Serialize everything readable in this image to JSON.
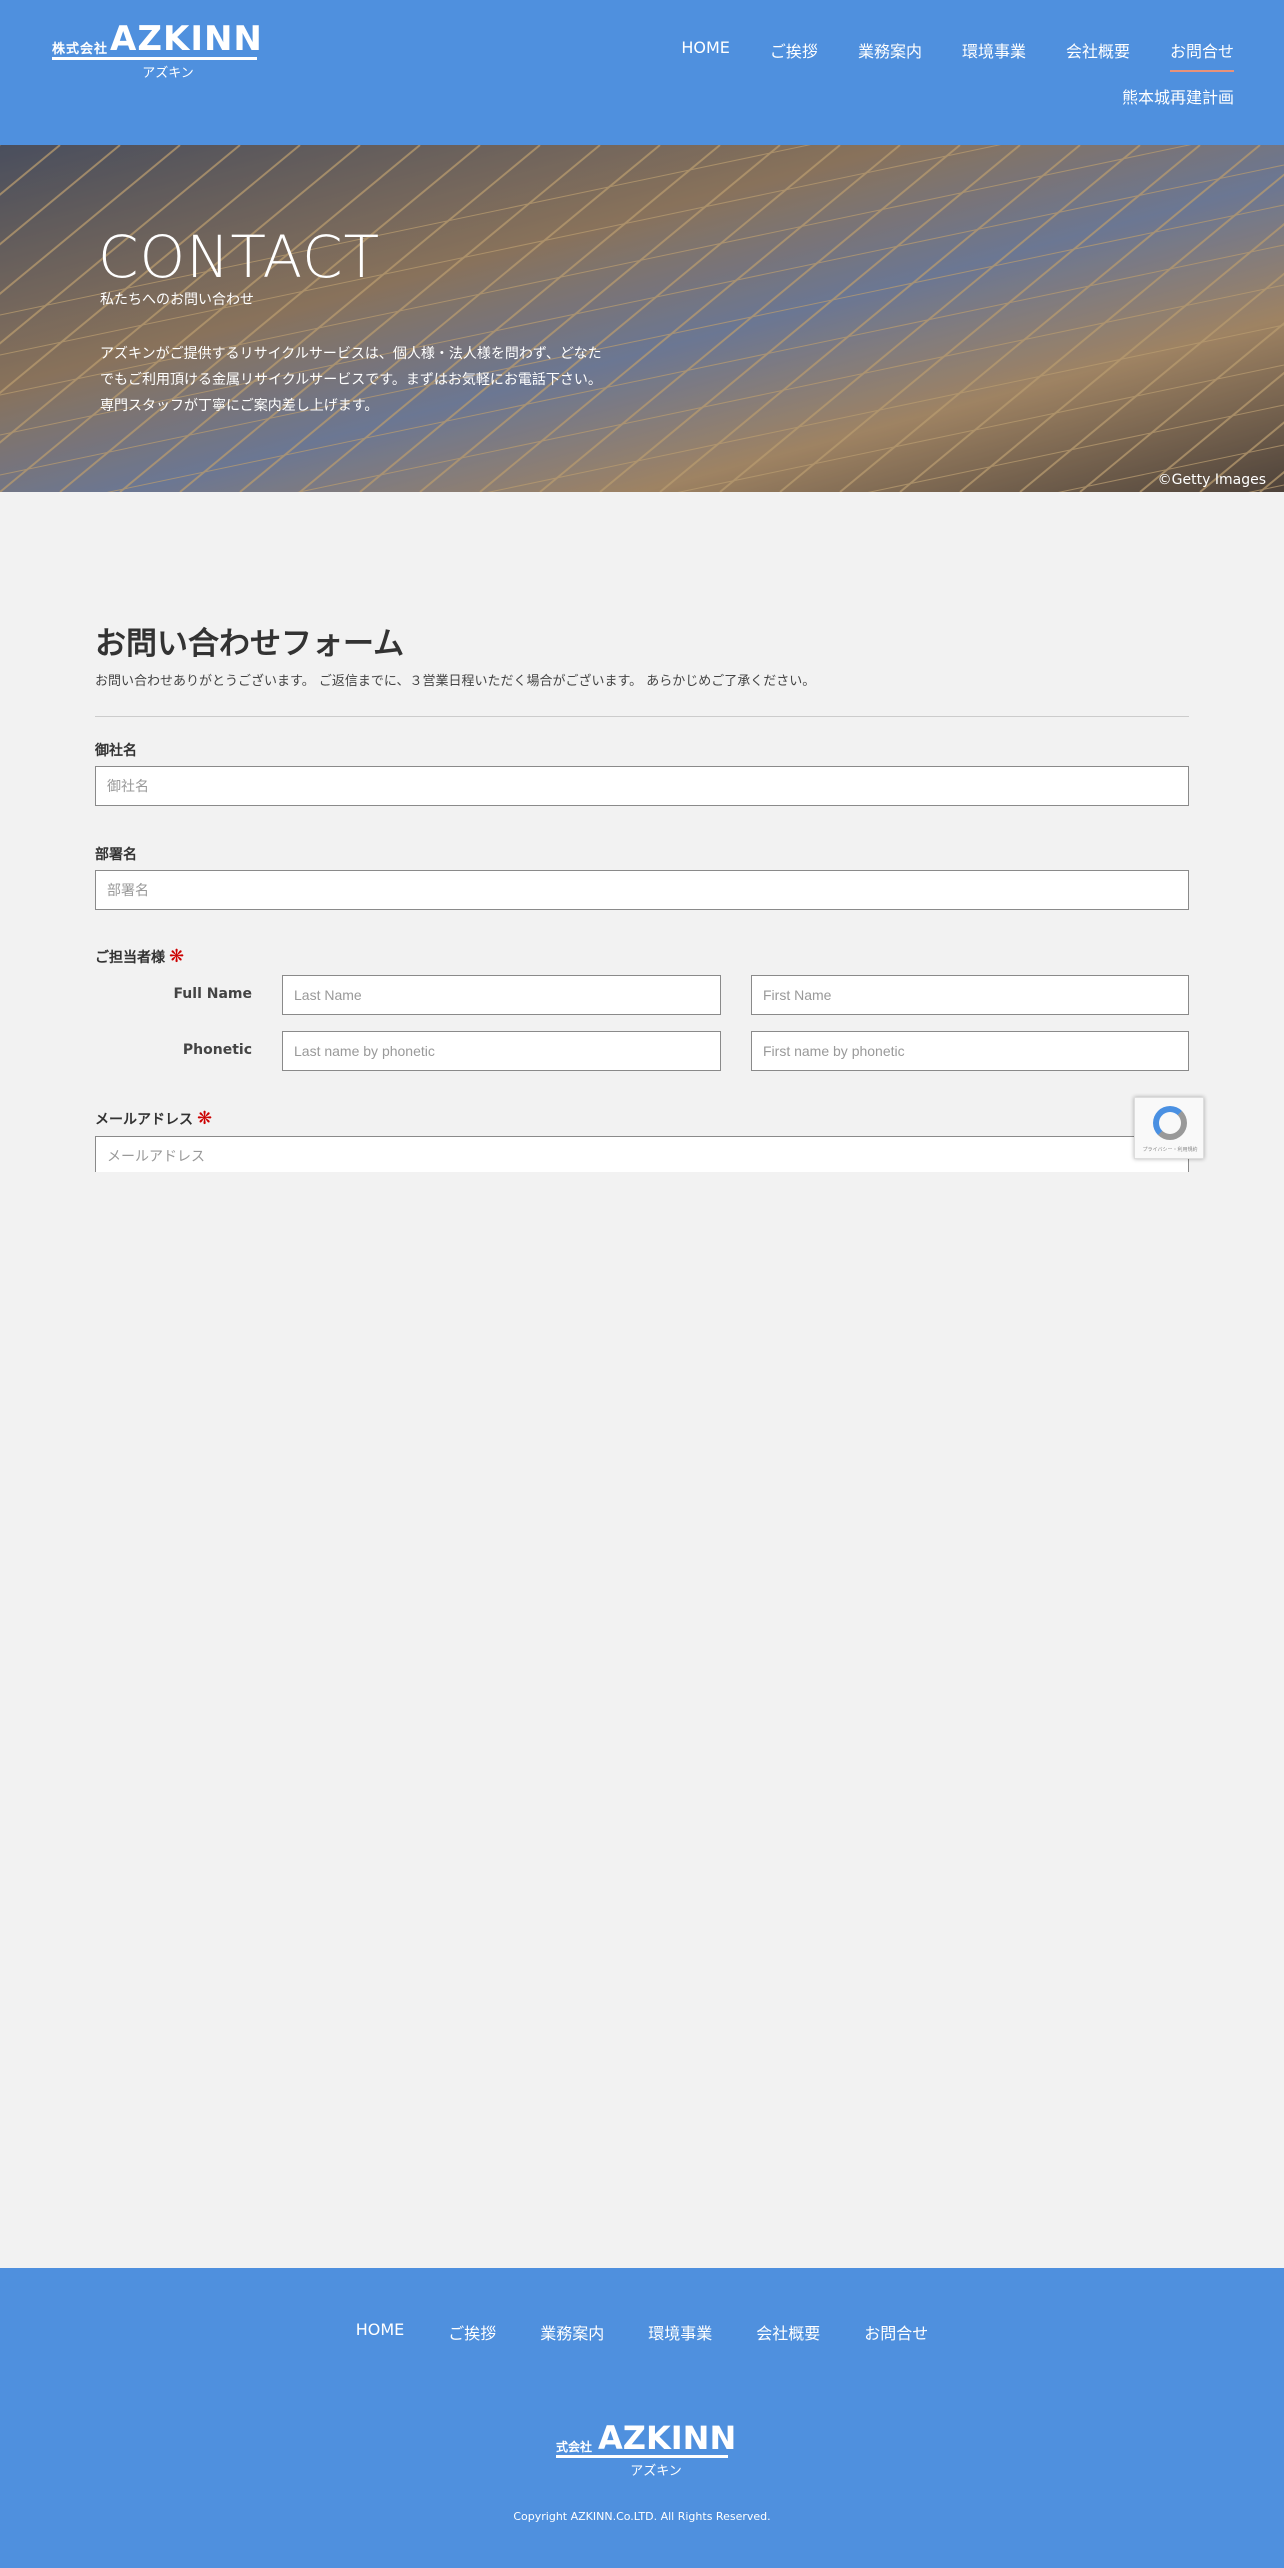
{
  "header": {
    "logo_prefix": "株式会社",
    "logo_mark": "AZKINN",
    "logo_kana": "アズキン",
    "nav": [
      "HOME",
      "ご挨拶",
      "業務案内",
      "環境事業",
      "会社概要",
      "お問合せ"
    ],
    "nav_second": "熊本城再建計画",
    "active_item": "お問合せ"
  },
  "hero": {
    "title": "CONTACT",
    "subtitle": "私たちへのお問い合わせ",
    "description": "アズキンがご提供するリサイクルサービスは、個人様・法人様を問わず、どなたでもご利用頂ける金属リサイクルサービスです。まずはお気軽にお電話下さい。専門スタッフが丁寧にご案内差し上げます。",
    "credit": "©Getty Images"
  },
  "form": {
    "title": "お問い合わせフォーム",
    "intro": "お問い合わせありがとうございます。 ご返信までに、３営業日程いただく場合がございます。 あらかじめご了承ください。",
    "company_label": "御社名",
    "company_placeholder": "御社名",
    "department_label": "部署名",
    "department_placeholder": "部署名",
    "contact_label": "ご担当者様",
    "fullname_label": "Full Name",
    "lastname_placeholder": "Last Name",
    "firstname_placeholder": "First Name",
    "phonetic_label": "Phonetic",
    "lastname_phonetic_placeholder": "Last name by phonetic",
    "firstname_phonetic_placeholder": "First name by phonetic",
    "email_label": "メールアドレス",
    "email_placeholder": "メールアドレス",
    "required_mark": "❋",
    "recaptcha_text": "プライバシー・利用規約"
  },
  "footer": {
    "nav": [
      "HOME",
      "ご挨拶",
      "業務案内",
      "環境事業",
      "会社概要",
      "お問合せ"
    ],
    "logo_prefix": "式会社",
    "logo_mark": "AZKINN",
    "logo_kana": "アズキン",
    "copyright": "Copyright AZKINN.Co.LTD. All Rights Reserved."
  },
  "colors": {
    "brand_blue": "#4f90de",
    "active_underline": "#e8927a",
    "required_red": "#cc0000"
  }
}
